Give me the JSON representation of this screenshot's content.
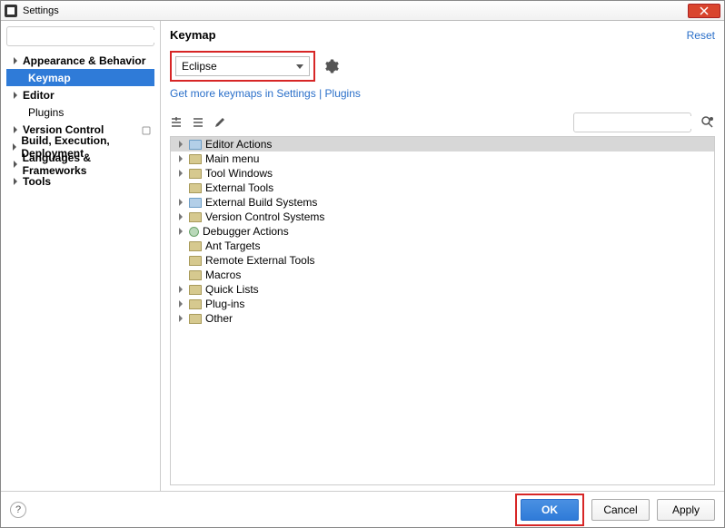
{
  "window": {
    "title": "Settings"
  },
  "sidebar": {
    "search_placeholder": "",
    "items": [
      {
        "label": "Appearance & Behavior",
        "bold": true,
        "expandable": true
      },
      {
        "label": "Keymap",
        "bold": true,
        "indent": true,
        "selected": true
      },
      {
        "label": "Editor",
        "bold": true,
        "expandable": true
      },
      {
        "label": "Plugins",
        "indent": true
      },
      {
        "label": "Version Control",
        "bold": true,
        "expandable": true,
        "overridable": true
      },
      {
        "label": "Build, Execution, Deployment",
        "bold": true,
        "expandable": true
      },
      {
        "label": "Languages & Frameworks",
        "bold": true,
        "expandable": true
      },
      {
        "label": "Tools",
        "bold": true,
        "expandable": true
      }
    ]
  },
  "content": {
    "title": "Keymap",
    "reset": "Reset",
    "combo_value": "Eclipse",
    "more_link": "Get more keymaps in Settings | Plugins",
    "action_search_placeholder": "",
    "tree": [
      {
        "label": "Editor Actions",
        "selected": true,
        "icon": "blue",
        "arrow": true
      },
      {
        "label": "Main menu",
        "icon": "fld",
        "arrow": true
      },
      {
        "label": "Tool Windows",
        "icon": "fld",
        "arrow": true
      },
      {
        "label": "External Tools",
        "icon": "fld"
      },
      {
        "label": "External Build Systems",
        "icon": "blue",
        "arrow": true
      },
      {
        "label": "Version Control Systems",
        "icon": "fld",
        "arrow": true
      },
      {
        "label": "Debugger Actions",
        "icon": "green",
        "arrow": true
      },
      {
        "label": "Ant Targets",
        "icon": "fld"
      },
      {
        "label": "Remote External Tools",
        "icon": "fld"
      },
      {
        "label": "Macros",
        "icon": "fld"
      },
      {
        "label": "Quick Lists",
        "icon": "fld",
        "arrow": true
      },
      {
        "label": "Plug-ins",
        "icon": "fld",
        "arrow": true
      },
      {
        "label": "Other",
        "icon": "fld",
        "arrow": true
      }
    ]
  },
  "footer": {
    "ok": "OK",
    "cancel": "Cancel",
    "apply": "Apply",
    "help": "?"
  }
}
